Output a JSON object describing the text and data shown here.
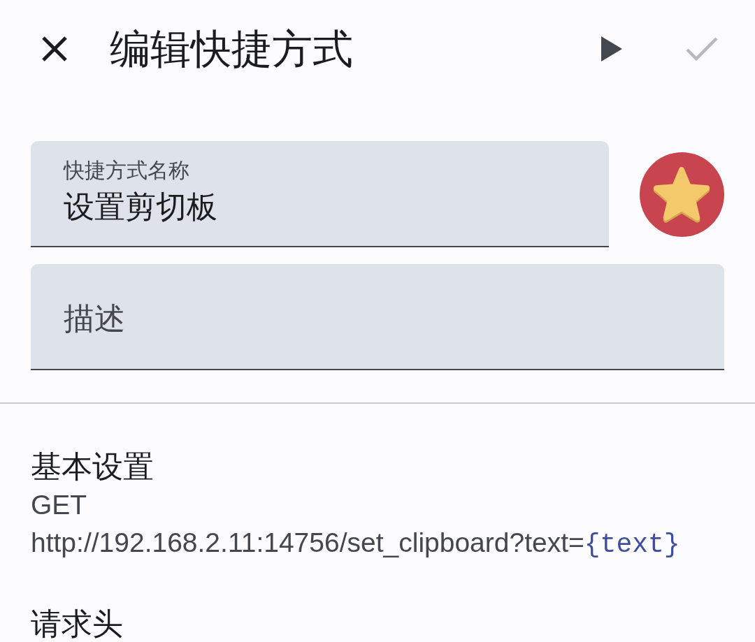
{
  "app_bar": {
    "title": "编辑快捷方式",
    "actions": [
      {
        "kind": "run",
        "disabled": false
      },
      {
        "kind": "save",
        "disabled": true
      }
    ]
  },
  "name_field": {
    "label": "快捷方式名称",
    "value": "设置剪切板"
  },
  "description_field": {
    "placeholder": "描述"
  },
  "sections": [
    {
      "heading": "基本设置",
      "method": "GET",
      "url": [
        {
          "kind": "plain",
          "text": "http://192.168.2.11:14756/set_clipboard?text="
        },
        {
          "kind": "variable",
          "text": "{text}"
        }
      ]
    },
    {
      "heading": "请求头"
    }
  ]
}
